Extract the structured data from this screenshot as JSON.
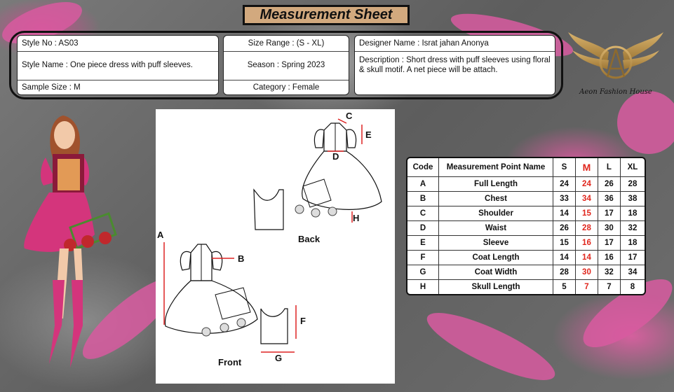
{
  "title": "Measurement Sheet",
  "info": {
    "style_no": "Style No : AS03",
    "style_name": "Style Name : One piece dress with puff sleeves.",
    "sample_size": "Sample Size : M",
    "size_range": "Size Range : (S - XL)",
    "season": "Season : Spring 2023",
    "category": "Category : Female",
    "designer": "Designer Name : Israt jahan Anonya",
    "description": "Description : Short dress with puff sleeves using floral & skull motif. A net piece will be attach."
  },
  "logo": {
    "letter": "A",
    "brand": "Aeon Fashion House",
    "icon": "winged-a-logo"
  },
  "sketch": {
    "back_label": "Back",
    "front_label": "Front",
    "markers": [
      "A",
      "B",
      "C",
      "D",
      "E",
      "F",
      "G",
      "H"
    ]
  },
  "table": {
    "headers": [
      "Code",
      "Measurement Point Name",
      "S",
      "M",
      "L",
      "XL"
    ],
    "rows": [
      [
        "A",
        "Full Length",
        "24",
        "24",
        "26",
        "28"
      ],
      [
        "B",
        "Chest",
        "33",
        "34",
        "36",
        "38"
      ],
      [
        "C",
        "Shoulder",
        "14",
        "15",
        "17",
        "18"
      ],
      [
        "D",
        "Waist",
        "26",
        "28",
        "30",
        "32"
      ],
      [
        "E",
        "Sleeve",
        "15",
        "16",
        "17",
        "18"
      ],
      [
        "F",
        "Coat Length",
        "14",
        "14",
        "16",
        "17"
      ],
      [
        "G",
        "Coat Width",
        "28",
        "30",
        "32",
        "34"
      ],
      [
        "H",
        "Skull Length",
        "5",
        "7",
        "7",
        "8"
      ]
    ]
  },
  "colors": {
    "highlight": "#e0261d",
    "title_bg": "#d2a97e",
    "accent_pink": "#d4357c"
  }
}
